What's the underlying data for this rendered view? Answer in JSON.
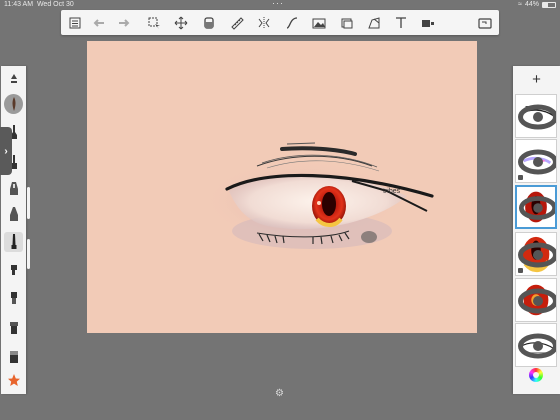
{
  "status_bar": {
    "time": "11:43 AM",
    "date": "Wed Oct 30",
    "battery": "44%"
  },
  "toolbar": {
    "icons": [
      "layer-list-icon",
      "undo-icon",
      "redo-icon",
      "select-icon",
      "transform-icon",
      "fill-icon",
      "ruler-icon",
      "symmetry-icon",
      "curve-icon",
      "image-import-icon",
      "layers-stack-icon",
      "perspective-icon",
      "text-icon",
      "record-icon",
      "fullscreen-icon"
    ]
  },
  "left_toolbar": {
    "brushes": [
      "brush-up-icon",
      "brush-round-icon",
      "brush-ink-icon",
      "brush-marker-icon",
      "brush-airbrush-icon",
      "brush-soft-icon",
      "brush-pencil-active-icon",
      "brush-chisel-icon",
      "brush-square-icon",
      "brush-smudge-icon",
      "brush-eraser-icon",
      "favorites-star-icon"
    ],
    "active_index": 6
  },
  "canvas": {
    "annotation": "tribes"
  },
  "layers_panel": {
    "add_label": "+"
  },
  "colors": {
    "canvas_bg": "#f2cbb7",
    "accent": "#4a9bd6",
    "iris": "#d22a10"
  }
}
